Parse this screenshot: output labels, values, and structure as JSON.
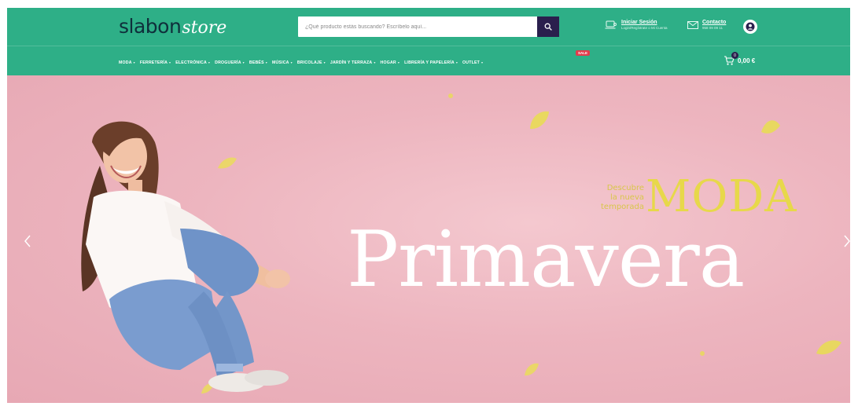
{
  "brand": {
    "logo_main": "slabon",
    "logo_script": "store",
    "colors": {
      "header": "#2eaf87",
      "search_button": "#2a1f4d",
      "hero_bg": "#edb5bf",
      "accent_yellow": "#e7d84a",
      "sale": "#e23b4b"
    }
  },
  "search": {
    "placeholder": "¿Qué producto estás buscando? Escríbelo aquí..."
  },
  "header_links": {
    "login": {
      "line1": "Iniciar Sesión",
      "line2": "Login/Regístrate o Mi Cuenta"
    },
    "contact": {
      "line1": "Contacto",
      "line2": "958 09 09 11"
    }
  },
  "nav": {
    "items": [
      {
        "label": "MODA"
      },
      {
        "label": "FERRETERÍA"
      },
      {
        "label": "ELECTRÓNICA"
      },
      {
        "label": "DROGUERÍA"
      },
      {
        "label": "BEBÉS"
      },
      {
        "label": "MÚSICA"
      },
      {
        "label": "BRICOLAJE"
      },
      {
        "label": "JARDÍN Y TERRAZA"
      },
      {
        "label": "HOGAR"
      },
      {
        "label": "LIBRERÍA Y PAPELERÍA"
      },
      {
        "label": "OUTLET"
      }
    ],
    "sale_badge": "SALE"
  },
  "cart": {
    "count": "0",
    "total": "0,00 €"
  },
  "hero": {
    "line1": "Descubre",
    "line2": "la nueva",
    "line3": "temporada",
    "moda": "MODA",
    "title": "Primavera"
  },
  "icons": {
    "search": "search-icon",
    "login": "laptop-user-icon",
    "contact": "envelope-icon",
    "account": "user-avatar-icon",
    "cart": "cart-icon",
    "prev": "chevron-left-icon",
    "next": "chevron-right-icon"
  }
}
